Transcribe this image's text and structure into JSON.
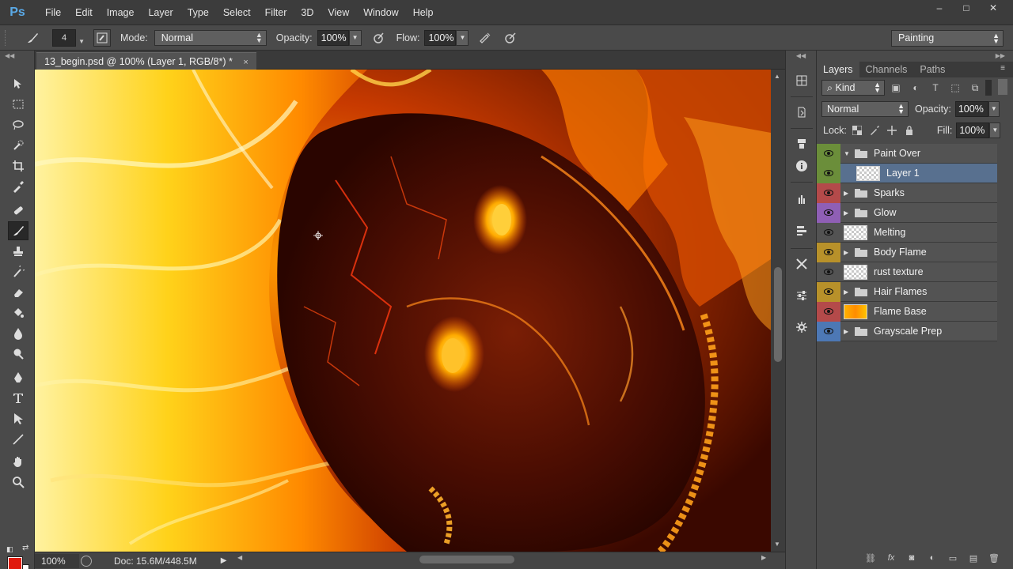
{
  "app": {
    "logo_text": "Ps",
    "menu": [
      "File",
      "Edit",
      "Image",
      "Layer",
      "Type",
      "Select",
      "Filter",
      "3D",
      "View",
      "Window",
      "Help"
    ],
    "window_controls": {
      "minimize": "–",
      "maximize": "□",
      "close": "✕"
    }
  },
  "options": {
    "brush_size": "4",
    "mode_label": "Mode:",
    "mode_value": "Normal",
    "opacity_label": "Opacity:",
    "opacity_value": "100%",
    "flow_label": "Flow:",
    "flow_value": "100%",
    "workspace": "Painting"
  },
  "document": {
    "tab_title": "13_begin.psd @ 100% (Layer 1, RGB/8*) *",
    "tab_close": "×",
    "zoom": "100%",
    "doc_size": "Doc: 15.6M/448.5M"
  },
  "colors": {
    "foreground": "#e01a0e",
    "background": "#ffffff",
    "selected_layer": "#58708f"
  },
  "layers_panel": {
    "tabs": [
      "Layers",
      "Channels",
      "Paths"
    ],
    "kind": "Kind",
    "blend_mode": "Normal",
    "opacity_label": "Opacity:",
    "opacity_value": "100%",
    "lock_label": "Lock:",
    "fill_label": "Fill:",
    "fill_value": "100%",
    "layers": [
      {
        "name": "Paint Over",
        "type": "group",
        "expanded": true,
        "eye_color": "#6b8e3a"
      },
      {
        "name": "Layer 1",
        "type": "layer",
        "selected": true,
        "eye_color": "#6b8e3a",
        "thumb": "transparent"
      },
      {
        "name": "Sparks",
        "type": "group",
        "eye_color": "#b44a4a"
      },
      {
        "name": "Glow",
        "type": "group",
        "eye_color": "#8f5fb5"
      },
      {
        "name": "Melting",
        "type": "layer",
        "eye_color": "",
        "thumb": "transparent"
      },
      {
        "name": "Body Flame",
        "type": "group",
        "eye_color": "#b8912a"
      },
      {
        "name": "rust texture",
        "type": "layer",
        "eye_color": "",
        "thumb": "transparent"
      },
      {
        "name": "Hair Flames",
        "type": "group",
        "eye_color": "#b8912a"
      },
      {
        "name": "Flame Base",
        "type": "layer",
        "eye_color": "#b44a4a",
        "thumb": "flame"
      },
      {
        "name": "Grayscale Prep",
        "type": "group",
        "eye_color": "#4d78b5"
      }
    ]
  }
}
